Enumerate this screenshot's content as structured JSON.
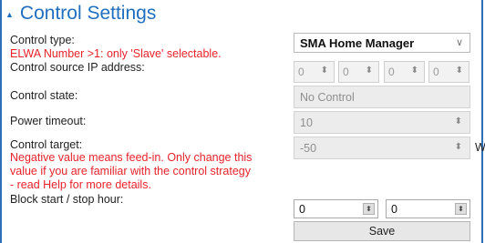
{
  "section": {
    "title": "Control Settings",
    "caret": "▲"
  },
  "control_type": {
    "label": "Control type:",
    "warning": "ELWA Number >1: only 'Slave' selectable.",
    "value": "SMA Home Manager",
    "chevron": "∨"
  },
  "ip": {
    "label": "Control source IP address:",
    "octets": [
      "0",
      "0",
      "0",
      "0"
    ],
    "spin": "⬍"
  },
  "state": {
    "label": "Control state:",
    "value": "No Control"
  },
  "timeout": {
    "label": "Power timeout:",
    "value": "10"
  },
  "target": {
    "label": "Control target:",
    "warning_lines": [
      "Negative value means feed-in. Only change this",
      "value if you are familiar with the control strategy",
      "- read Help for more details."
    ],
    "value": "-50",
    "unit": "W"
  },
  "block": {
    "label": "Block start / stop hour:",
    "start": "0",
    "stop": "0",
    "stepper": "⬍"
  },
  "save_label": "Save"
}
